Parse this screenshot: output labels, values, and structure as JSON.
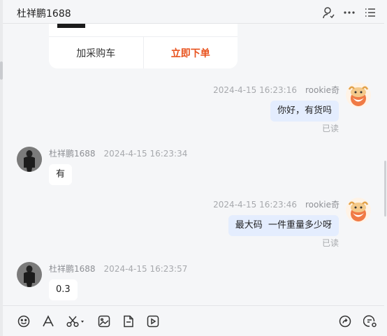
{
  "header": {
    "title": "杜祥鹏1688",
    "icons": [
      "profile-icon",
      "more-icon",
      "menu-list-icon"
    ]
  },
  "product_card": {
    "add_to_cart_label": "加采购车",
    "buy_now_label": "立即下单"
  },
  "messages": [
    {
      "sender": "rookie奇",
      "time": "2024-4-15 16:23:16",
      "text": "你好，有货吗",
      "status": "已读",
      "mine": true
    },
    {
      "sender": "杜祥鹏1688",
      "time": "2024-4-15 16:23:34",
      "text": "有",
      "mine": false
    },
    {
      "sender": "rookie奇",
      "time": "2024-4-15 16:23:46",
      "text": "最大码  一件重量多少呀",
      "status": "已读",
      "mine": true
    },
    {
      "sender": "杜祥鹏1688",
      "time": "2024-4-15 16:23:57",
      "text": "0.3",
      "mine": false
    }
  ],
  "composer": {
    "tools": [
      "emoji-icon",
      "text-format-icon",
      "scissors-icon",
      "image-icon",
      "file-icon",
      "video-icon"
    ],
    "right_tools": [
      "share-icon",
      "chat-settings-icon"
    ]
  },
  "colors": {
    "accent": "#e8521d",
    "my_bubble": "#e4edfe",
    "their_bubble": "#ffffff",
    "background": "#f5f6f8"
  }
}
